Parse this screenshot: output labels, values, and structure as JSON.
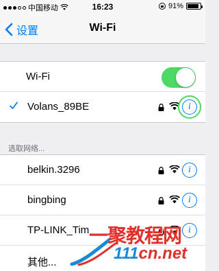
{
  "status_bar": {
    "carrier": "中国移动",
    "time": "16:23",
    "battery": "91%"
  },
  "nav": {
    "back_label": "设置",
    "title": "Wi-Fi"
  },
  "wifi_toggle": {
    "label": "Wi-Fi",
    "state": "on"
  },
  "connected_network": {
    "name": "Volans_89BE",
    "secured": true
  },
  "section_header": "选取网络...",
  "networks": [
    {
      "name": "belkin.3296",
      "secured": true
    },
    {
      "name": "bingbing",
      "secured": true
    },
    {
      "name": "TP-LINK_Tim",
      "secured": true
    }
  ],
  "other_label": "其他...",
  "watermark": {
    "line1": "一聚教程网",
    "line2_blue": "111",
    "line2_red": "cn.net"
  },
  "colors": {
    "accent": "#007aff",
    "toggle_on": "#4cd964",
    "highlight": "#4cd964",
    "watermark_red": "#e0302a"
  }
}
